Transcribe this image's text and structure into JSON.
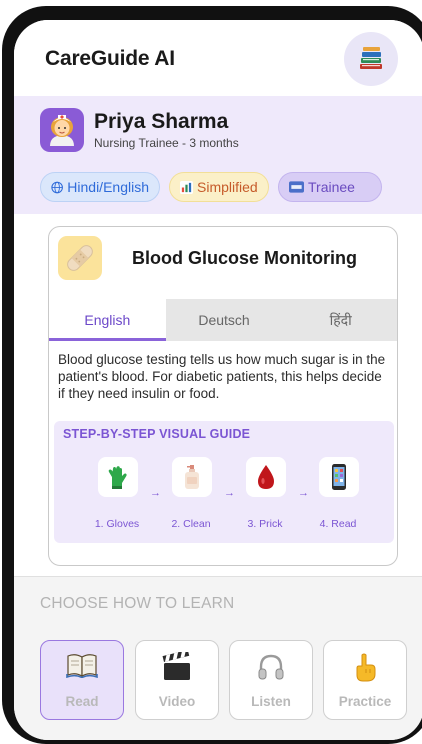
{
  "app": {
    "title": "CareGuide AI",
    "menu_icon": "books-icon"
  },
  "profile": {
    "name": "Priya Sharma",
    "role": "Nursing Trainee - 3 months",
    "avatar_icon": "nurse-icon",
    "tags": [
      {
        "icon": "globe-icon",
        "label": "Hindi/English"
      },
      {
        "icon": "bar-chart-icon",
        "label": "Simplified"
      },
      {
        "icon": "new-badge-icon",
        "label": "Trainee"
      }
    ]
  },
  "card": {
    "icon": "bandage-icon",
    "title": "Blood Glucose Monitoring",
    "tabs": [
      "English",
      "Deutsch",
      "हिंदी"
    ],
    "active_tab": "English",
    "description": "Blood glucose testing tells us how much sugar is in the patient's blood. For diabetic patients, this helps decide if they need insulin or food.",
    "guide": {
      "title": "STEP-BY-STEP VISUAL GUIDE",
      "steps": [
        {
          "icon": "gloves-icon",
          "label": "1. Gloves"
        },
        {
          "icon": "soap-bottle-icon",
          "label": "2. Clean"
        },
        {
          "icon": "blood-drop-icon",
          "label": "3. Prick"
        },
        {
          "icon": "phone-icon",
          "label": "4. Read"
        }
      ],
      "arrow": "→"
    }
  },
  "learn": {
    "title": "CHOOSE HOW TO LEARN",
    "modes": [
      {
        "icon": "book-icon",
        "label": "Read",
        "selected": true
      },
      {
        "icon": "clapper-icon",
        "label": "Video",
        "selected": false
      },
      {
        "icon": "headphones-icon",
        "label": "Listen",
        "selected": false
      },
      {
        "icon": "pointing-hand-icon",
        "label": "Practice",
        "selected": false
      }
    ]
  },
  "colors": {
    "accent": "#7b55d3",
    "profile_bg": "#efe9fb",
    "tag_lang": "#2f6bd9",
    "tag_simple": "#c65b2a",
    "tag_level": "#6a4cc0"
  }
}
